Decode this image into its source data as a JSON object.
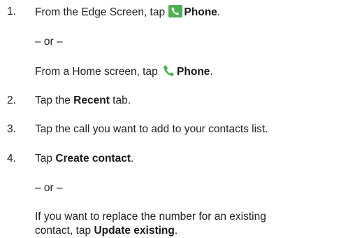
{
  "steps": [
    {
      "number": "1.",
      "line1": {
        "before": "From the Edge Screen, tap",
        "icon": "phone-app-icon",
        "bold": "Phone",
        "after": "."
      },
      "or": "– or –",
      "line2": {
        "before": "From a Home screen, tap",
        "icon": "phone-handset-icon",
        "bold": "Phone",
        "after": "."
      }
    },
    {
      "number": "2.",
      "before": "Tap the",
      "bold": "Recent",
      "after": "tab."
    },
    {
      "number": "3.",
      "text": "Tap the call you want to add to your contacts list."
    },
    {
      "number": "4.",
      "before": "Tap",
      "bold": "Create contact",
      "after": ".",
      "or": "– or –",
      "cont1": "If you want to replace the number for an existing",
      "cont2_before": "contact, tap",
      "cont2_bold": "Update existing",
      "cont2_after": "."
    }
  ],
  "colors": {
    "phone_app_bg": "#4caf50",
    "handset": "#4caf50",
    "text": "#222222"
  }
}
